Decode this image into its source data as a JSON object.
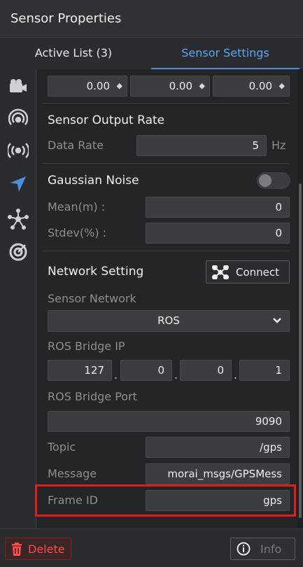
{
  "window": {
    "title": "Sensor Properties"
  },
  "tabs": [
    {
      "label": "Active List  (3)"
    },
    {
      "label": "Sensor Settings"
    }
  ],
  "sidebar_icons": [
    "camera-icon",
    "radar-icon",
    "broadcast-icon",
    "navigation-arrow-icon",
    "network-node-icon",
    "target-icon"
  ],
  "position": {
    "values": [
      "0.00",
      "0.00",
      "0.00"
    ]
  },
  "output_rate": {
    "title": "Sensor Output Rate",
    "data_rate_label": "Data Rate",
    "data_rate_value": "5",
    "unit": "Hz"
  },
  "noise": {
    "title": "Gaussian Noise",
    "mean_label": "Mean(m) :",
    "mean_value": "0",
    "stdev_label": "Stdev(%) :",
    "stdev_value": "0",
    "enabled": false
  },
  "network": {
    "title": "Network Setting",
    "connect_label": "Connect",
    "sensor_network_label": "Sensor Network",
    "sensor_network_value": "ROS",
    "bridge_ip_label": "ROS Bridge IP",
    "bridge_ip": [
      "127",
      "0",
      "0",
      "1"
    ],
    "bridge_port_label": "ROS Bridge Port",
    "bridge_port_value": "9090",
    "topic_label": "Topic",
    "topic_value": "/gps",
    "message_label": "Message",
    "message_value": "morai_msgs/GPSMess",
    "frame_label": "Frame ID",
    "frame_value": "gps"
  },
  "footer": {
    "delete_label": "Delete",
    "info_label": "Info"
  },
  "colors": {
    "accent": "#4a8fdc",
    "danger": "#ff4a4a",
    "highlight": "#e01e1e"
  }
}
